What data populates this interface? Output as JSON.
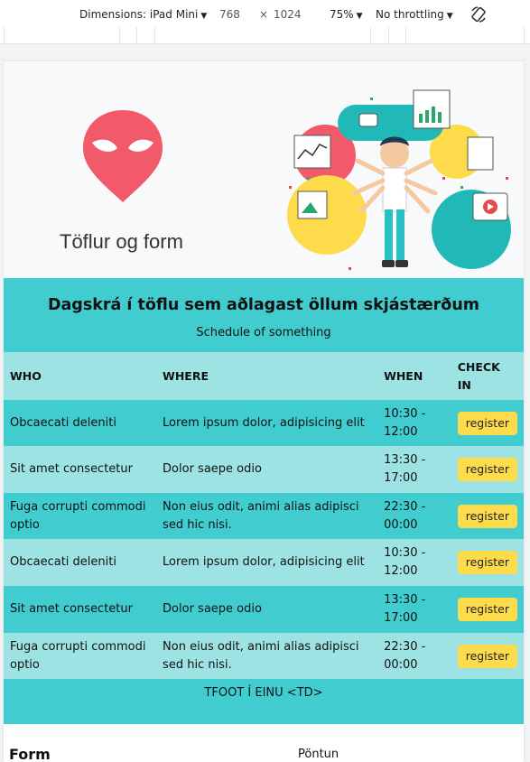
{
  "devtools": {
    "device_label": "Dimensions: iPad Mini",
    "width": "768",
    "times": "×",
    "height": "1024",
    "zoom": "75%",
    "throttle": "No throttling"
  },
  "hero": {
    "brand": "Töflur og form"
  },
  "table": {
    "caption_title": "Dagskrá í töflu sem aðlagast öllum skjástærðum",
    "caption_sub": "Schedule of something",
    "headers": [
      "WHO",
      "WHERE",
      "WHEN",
      "CHECK IN"
    ],
    "rows": [
      {
        "who": "Obcaecati deleniti",
        "where": "Lorem ipsum dolor, adipisicing elit",
        "when": "10:30 - 12:00",
        "button": "register"
      },
      {
        "who": "Sit amet consectetur",
        "where": "Dolor saepe odio",
        "when": "13:30 - 17:00",
        "button": "register"
      },
      {
        "who": "Fuga corrupti commodi optio",
        "where": "Non eius odit, animi alias adipisci sed hic nisi.",
        "when": "22:30 - 00:00",
        "button": "register"
      },
      {
        "who": "Obcaecati deleniti",
        "where": "Lorem ipsum dolor, adipisicing elit",
        "when": "10:30 - 12:00",
        "button": "register"
      },
      {
        "who": "Sit amet consectetur",
        "where": "Dolor saepe odio",
        "when": "13:30 - 17:00",
        "button": "register"
      },
      {
        "who": "Fuga corrupti commodi optio",
        "where": "Non eius odit, animi alias adipisci sed hic nisi.",
        "when": "22:30 - 00:00",
        "button": "register"
      }
    ],
    "tfoot": "TFOOT Í EINU <TD>"
  },
  "form": {
    "heading": "Form",
    "right_label": "Pöntun"
  },
  "colors": {
    "teal": "#41cdd0",
    "light_teal": "#9de3e4",
    "button": "#fddb4a",
    "logo": "#f25a6b"
  }
}
